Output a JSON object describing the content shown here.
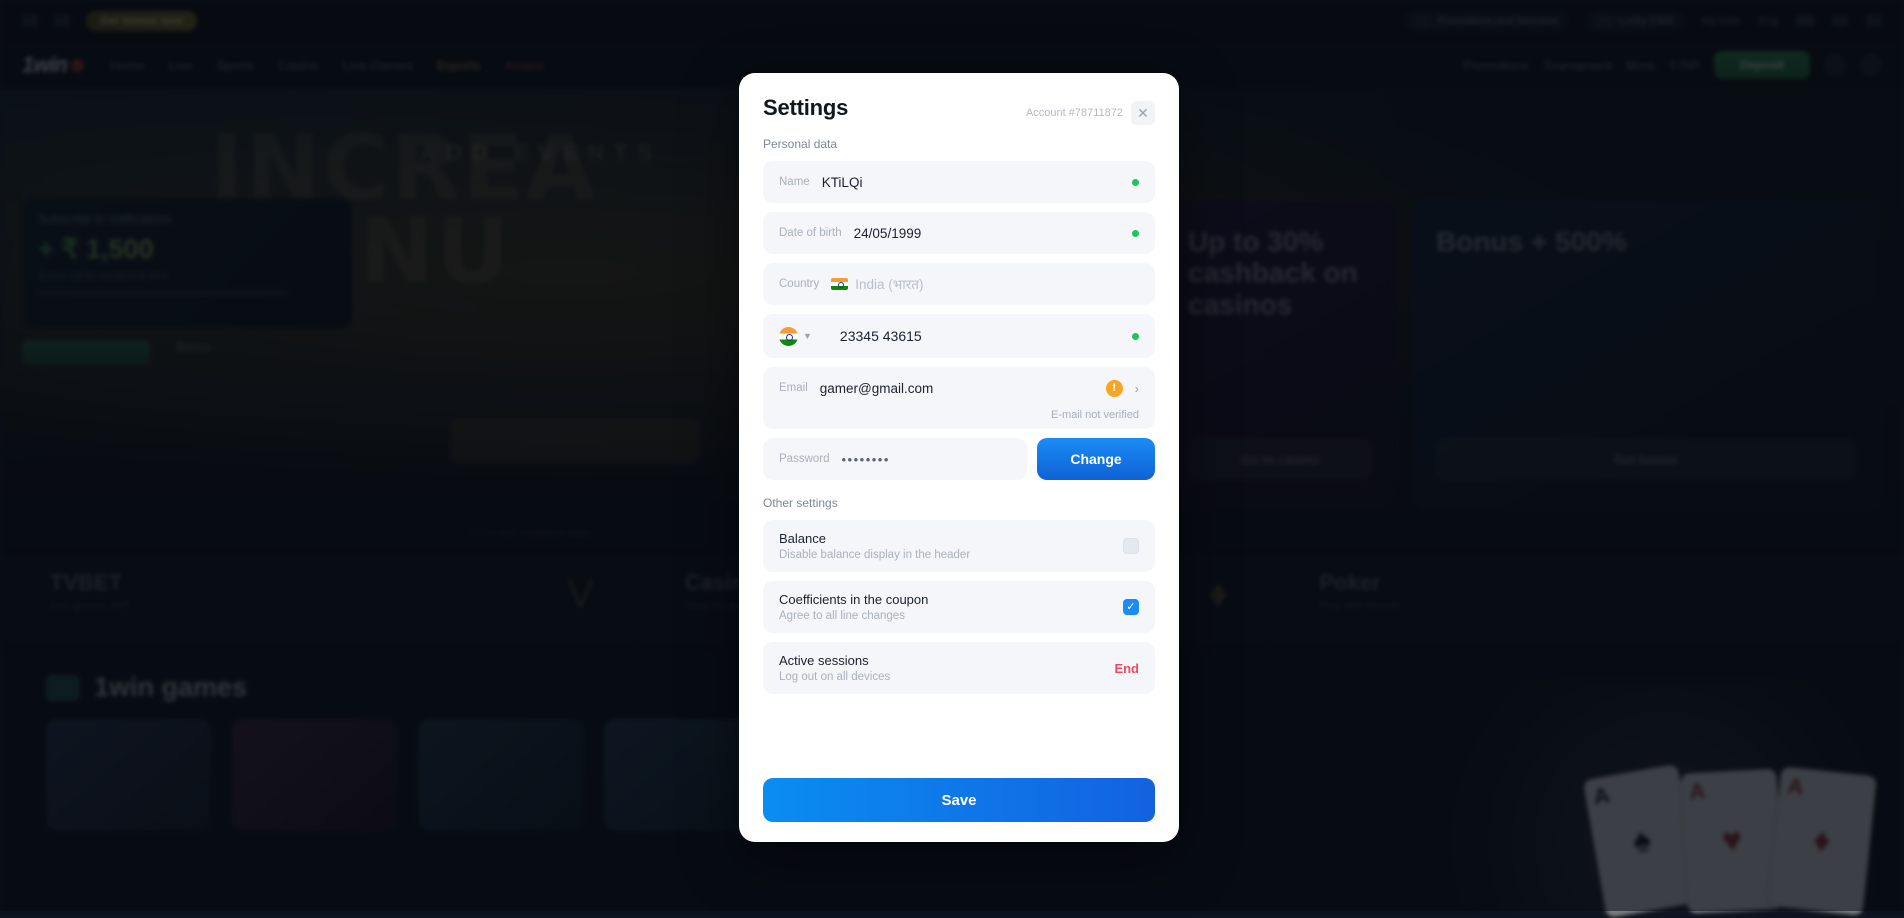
{
  "background": {
    "util_bar": {
      "promo_pill": "Get bonus now",
      "items": [
        "Promotions and bonuses",
        "Lucky Click",
        "My bets"
      ],
      "lang": "Eng"
    },
    "nav": {
      "logo": "1win",
      "links": [
        "Home",
        "Live",
        "Sports",
        "Casino",
        "Live-Games",
        "Esports",
        "Aviator"
      ],
      "right_links": [
        "Promotions",
        "Tournament",
        "More"
      ],
      "balance": "0 INR",
      "deposit_label": "Deposit"
    },
    "hero": {
      "sub": "ADD EVENTS",
      "title_line1": "INCREA",
      "title_line2": "BONU",
      "footer_note": "Terms and conditions apply"
    },
    "promo_card": {
      "title": "Subscribe to notifications",
      "amount": "+ ₹ 1,500",
      "sub": "Bonus will be credited in 24 h",
      "cta": "Subscribe",
      "cta2": "Bonus"
    },
    "banners": [
      {
        "id": "cashback",
        "heading": "Up to 30% cashback on casinos",
        "button": "Go to casino"
      },
      {
        "id": "bonus",
        "heading": "Bonus + 500%",
        "button": "Get bonus"
      }
    ],
    "categories": [
      {
        "title": "TVBET",
        "sub": "Live games 24/7"
      },
      {
        "title": "Casino",
        "sub": "More 60 games"
      },
      {
        "title": "Poker",
        "sub": "Play with friends"
      }
    ],
    "games_section": {
      "title": "1win games"
    }
  },
  "modal": {
    "title": "Settings",
    "account": "Account #78711872",
    "close_icon": "close-icon",
    "personal_data_label": "Personal data",
    "fields": {
      "name": {
        "label": "Name",
        "value": "KTiLQi",
        "status": "ok"
      },
      "dob": {
        "label": "Date of birth",
        "value": "24/05/1999",
        "status": "ok"
      },
      "country": {
        "label": "Country",
        "value": "India (भारत)",
        "status": "empty"
      },
      "phone": {
        "value": "23345 43615",
        "status": "ok",
        "flag": "india-flag-icon"
      },
      "email": {
        "label": "Email",
        "value": "gamer@gmail.com",
        "note": "E-mail not verified",
        "warn_icon": "warning-icon",
        "arrow_icon": "chevron-right-icon"
      },
      "password": {
        "label": "Password",
        "value": "••••••••",
        "change_label": "Change"
      }
    },
    "other_settings_label": "Other settings",
    "options": [
      {
        "title": "Balance",
        "subtitle": "Disable balance display in the header",
        "control": "toggle",
        "checked": false
      },
      {
        "title": "Coefficients in the coupon",
        "subtitle": "Agree to all line changes",
        "control": "checkbox",
        "checked": true
      },
      {
        "title": "Active sessions",
        "subtitle": "Log out on all devices",
        "control": "link",
        "action_label": "End"
      }
    ],
    "save_label": "Save"
  },
  "colors": {
    "accent_blue": "#1b8cf5",
    "danger_red": "#ef4a5a",
    "success_green": "#1fc45a",
    "warn_orange": "#f5a623"
  }
}
